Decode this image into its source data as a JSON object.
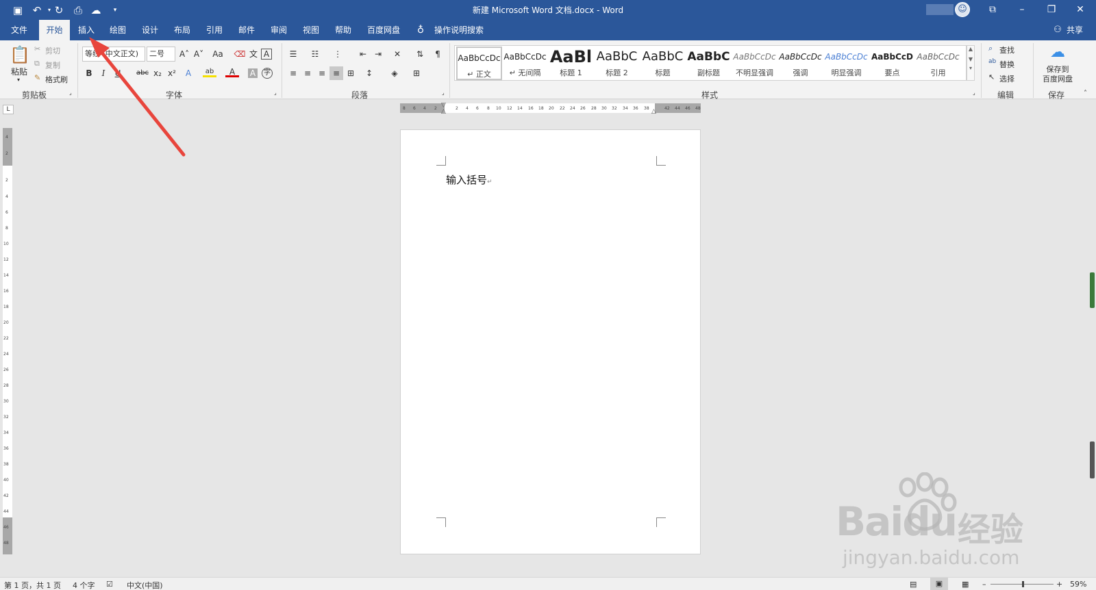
{
  "window": {
    "title": "新建 Microsoft Word 文档.docx  -  Word",
    "quick_access": [
      "save-icon",
      "undo-icon",
      "redo-icon",
      "print-preview-icon",
      "baidu-save-icon",
      "customize-icon"
    ],
    "controls": [
      "ribbon-display-icon",
      "minimize-icon",
      "restore-icon",
      "close-icon"
    ]
  },
  "tabs": [
    {
      "label": "文件"
    },
    {
      "label": "开始",
      "active": true
    },
    {
      "label": "插入"
    },
    {
      "label": "绘图"
    },
    {
      "label": "设计"
    },
    {
      "label": "布局"
    },
    {
      "label": "引用"
    },
    {
      "label": "邮件"
    },
    {
      "label": "审阅"
    },
    {
      "label": "视图"
    },
    {
      "label": "帮助"
    },
    {
      "label": "百度网盘"
    }
  ],
  "tell_me": "操作说明搜索",
  "share": "共享",
  "clipboard": {
    "group": "剪贴板",
    "paste": "粘贴",
    "cut": "剪切",
    "copy": "复制",
    "format_painter": "格式刷"
  },
  "font": {
    "group": "字体",
    "name": "等线 (中文正文)",
    "size": "二号",
    "bold": "B",
    "italic": "I",
    "underline": "U",
    "strike": "abc",
    "sub": "x₂",
    "sup": "x²",
    "grow": "A˄",
    "shrink": "A˅",
    "case": "Aa",
    "phonetic": "文",
    "border": "A",
    "effects": "A",
    "highlight": "ab",
    "color": "A",
    "shading": "A",
    "enclose": "字"
  },
  "paragraph": {
    "group": "段落"
  },
  "styles": {
    "group": "样式",
    "items": [
      {
        "sample": "AaBbCcDc",
        "label": "↵ 正文",
        "selected": true
      },
      {
        "sample": "AaBbCcDc",
        "label": "↵ 无间隔"
      },
      {
        "sample": "AaBl",
        "label": "标题 1"
      },
      {
        "sample": "AaBbC",
        "label": "标题 2"
      },
      {
        "sample": "AaBbC",
        "label": "标题"
      },
      {
        "sample": "AaBbC",
        "label": "副标题"
      },
      {
        "sample": "AaBbCcDc",
        "label": "不明显强调"
      },
      {
        "sample": "AaBbCcDc",
        "label": "强调"
      },
      {
        "sample": "AaBbCcDc",
        "label": "明显强调"
      },
      {
        "sample": "AaBbCcD",
        "label": "要点"
      },
      {
        "sample": "AaBbCcDc",
        "label": "引用"
      }
    ]
  },
  "editing": {
    "group": "编辑",
    "find": "查找",
    "replace": "替换",
    "select": "选择"
  },
  "save_group": {
    "group": "保存",
    "button": "保存到\n百度网盘"
  },
  "ruler": {
    "h_left": [
      "8",
      "6",
      "4",
      "2"
    ],
    "h_main": [
      "2",
      "4",
      "6",
      "8",
      "10",
      "12",
      "14",
      "16",
      "18",
      "20",
      "22",
      "24",
      "26",
      "28",
      "30",
      "32",
      "34",
      "36",
      "38"
    ],
    "h_right": [
      "42",
      "44",
      "46",
      "48"
    ],
    "v_top": [
      "4",
      "2"
    ],
    "v_main": [
      "2",
      "4",
      "6",
      "8",
      "10",
      "12",
      "14",
      "16",
      "18",
      "20",
      "22",
      "24",
      "26",
      "28",
      "30",
      "32",
      "34",
      "36",
      "38",
      "40",
      "42",
      "44"
    ],
    "v_bottom": [
      "46",
      "48"
    ],
    "corner": "L"
  },
  "document": {
    "text": "输入括号"
  },
  "status": {
    "page": "第 1 页，共 1 页",
    "words": "4 个字",
    "language": "中文(中国)",
    "zoom": "59%"
  },
  "watermark": {
    "brand": "Baidu",
    "suffix": "经验",
    "url": "jingyan.baidu.com"
  },
  "colors": {
    "brand": "#2b579a",
    "arrow": "#e8453c",
    "ribbon": "#f3f3f3",
    "canvas": "#e6e6e6"
  }
}
